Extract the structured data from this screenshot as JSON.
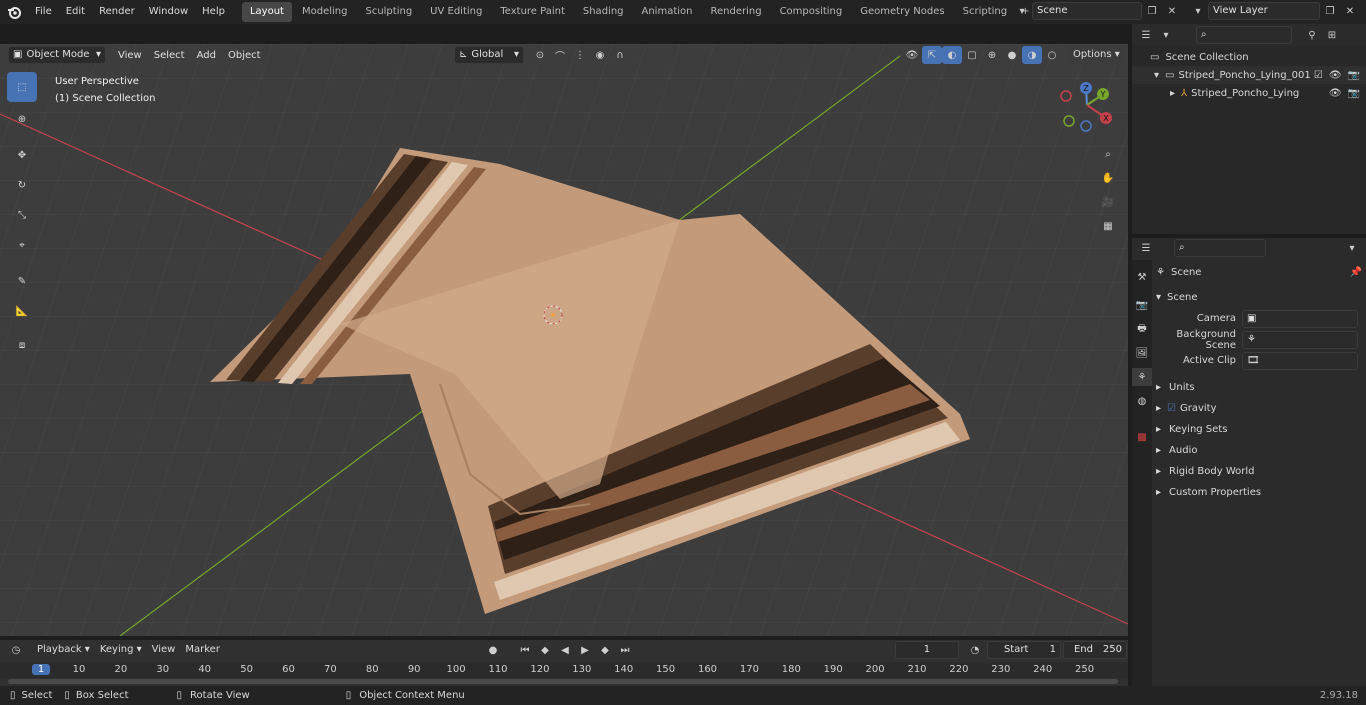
{
  "topbar": {
    "menus": [
      "File",
      "Edit",
      "Render",
      "Window",
      "Help"
    ],
    "workspaces": [
      "Layout",
      "Modeling",
      "Sculpting",
      "UV Editing",
      "Texture Paint",
      "Shading",
      "Animation",
      "Rendering",
      "Compositing",
      "Geometry Nodes",
      "Scripting"
    ],
    "active_workspace": "Layout",
    "add_workspace": "+",
    "scene_name": "Scene",
    "view_layer": "View Layer"
  },
  "viewport": {
    "mode": "Object Mode",
    "menus": [
      "View",
      "Select",
      "Add",
      "Object"
    ],
    "orientation": "Global",
    "options_label": "Options",
    "overlay_line1": "User Perspective",
    "overlay_line2": "(1) Scene Collection",
    "gizmo": {
      "x": "X",
      "y": "Y",
      "z": "Z"
    }
  },
  "outliner": {
    "root": "Scene Collection",
    "items": [
      {
        "label": "Striped_Poncho_Lying_001"
      },
      {
        "label": "Striped_Poncho_Lying"
      }
    ]
  },
  "properties": {
    "context": "Scene",
    "section": "Scene",
    "fields": [
      {
        "label": "Camera"
      },
      {
        "label": "Background Scene"
      },
      {
        "label": "Active Clip"
      }
    ],
    "panels": [
      "Units",
      "Gravity",
      "Keying Sets",
      "Audio",
      "Rigid Body World",
      "Custom Properties"
    ]
  },
  "timeline": {
    "menus": [
      "Playback",
      "Keying",
      "View",
      "Marker"
    ],
    "current_frame": "1",
    "start_label": "Start",
    "start": "1",
    "end_label": "End",
    "end": "250",
    "ticks": [
      "1",
      "10",
      "20",
      "30",
      "40",
      "50",
      "60",
      "70",
      "80",
      "90",
      "100",
      "110",
      "120",
      "130",
      "140",
      "150",
      "160",
      "170",
      "180",
      "190",
      "200",
      "210",
      "220",
      "230",
      "240",
      "250"
    ]
  },
  "statusbar": {
    "select": "Select",
    "box_select": "Box Select",
    "rotate": "Rotate View",
    "context_menu": "Object Context Menu",
    "version": "2.93.18"
  },
  "colors": {
    "accent": "#4772b3",
    "x_axis": "#c4414c",
    "y_axis": "#78a52b",
    "cloth": "#c39a7a"
  }
}
